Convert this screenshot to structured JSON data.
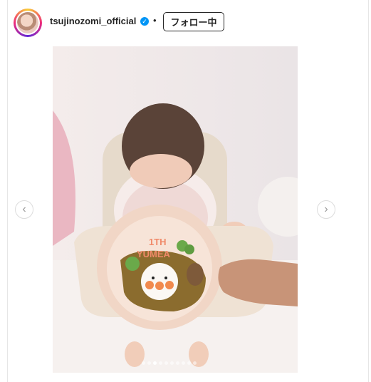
{
  "header": {
    "username": "tsujinozomi_official",
    "verified_icon": "verified-badge-icon",
    "separator": "•",
    "follow_label": "フォロー中"
  },
  "post": {
    "image_alt": "Baby in high chair with curry plate",
    "plate_text_line1": "1TH",
    "plate_text_line2": "YUMEA",
    "carousel": {
      "count": 10,
      "active_index": 2
    },
    "nav": {
      "prev_icon": "chevron-left-icon",
      "next_icon": "chevron-right-icon",
      "prev_glyph": "‹",
      "next_glyph": "›"
    }
  },
  "colors": {
    "accent": "#0095f6",
    "text": "#262626"
  }
}
